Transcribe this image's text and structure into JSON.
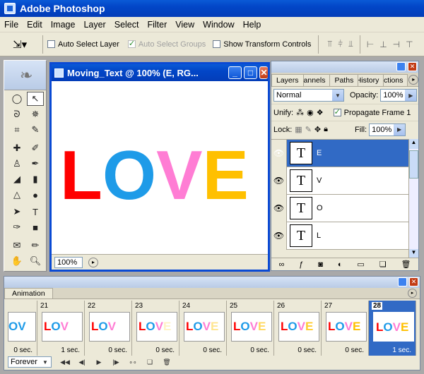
{
  "app": {
    "title": "Adobe Photoshop"
  },
  "menu": [
    "File",
    "Edit",
    "Image",
    "Layer",
    "Select",
    "Filter",
    "View",
    "Window",
    "Help"
  ],
  "options": {
    "auto_select_layer": "Auto Select Layer",
    "auto_select_groups": "Auto Select Groups",
    "show_transform": "Show Transform Controls"
  },
  "document": {
    "title": "Moving_Text @ 100% (E, RG...",
    "letters": [
      {
        "char": "L",
        "color": "#ff0000"
      },
      {
        "char": "O",
        "color": "#1e9be8"
      },
      {
        "char": "V",
        "color": "#ff7dd4"
      },
      {
        "char": "E",
        "color": "#ffc000"
      }
    ],
    "zoom": "100%"
  },
  "layers_panel": {
    "tabs": [
      "Layers",
      "Channels",
      "Paths",
      "History",
      "Actions"
    ],
    "blend_mode": "Normal",
    "opacity_label": "Opacity:",
    "opacity": "100%",
    "unify_label": "Unify:",
    "propagate": "Propagate Frame 1",
    "lock_label": "Lock:",
    "fill_label": "Fill:",
    "fill": "100%",
    "layers": [
      {
        "name": "E",
        "selected": true
      },
      {
        "name": "V",
        "selected": false
      },
      {
        "name": "O",
        "selected": false
      },
      {
        "name": "L",
        "selected": false
      }
    ]
  },
  "animation": {
    "tab": "Animation",
    "loop": "Forever",
    "frames": [
      {
        "num": "",
        "text": "OV",
        "delay": "0 sec."
      },
      {
        "num": "21",
        "text": "LOV",
        "delay": "1 sec."
      },
      {
        "num": "22",
        "text": "LOV",
        "delay": "0 sec."
      },
      {
        "num": "23",
        "text": "LOVE",
        "delay": "0 sec."
      },
      {
        "num": "24",
        "text": "LOVE",
        "delay": "0 sec."
      },
      {
        "num": "25",
        "text": "LOVE",
        "delay": "0 sec."
      },
      {
        "num": "26",
        "text": "LOVE",
        "delay": "0 sec."
      },
      {
        "num": "27",
        "text": "LOVE",
        "delay": "0 sec."
      },
      {
        "num": "28",
        "text": "LOVE",
        "delay": "1 sec."
      }
    ]
  }
}
